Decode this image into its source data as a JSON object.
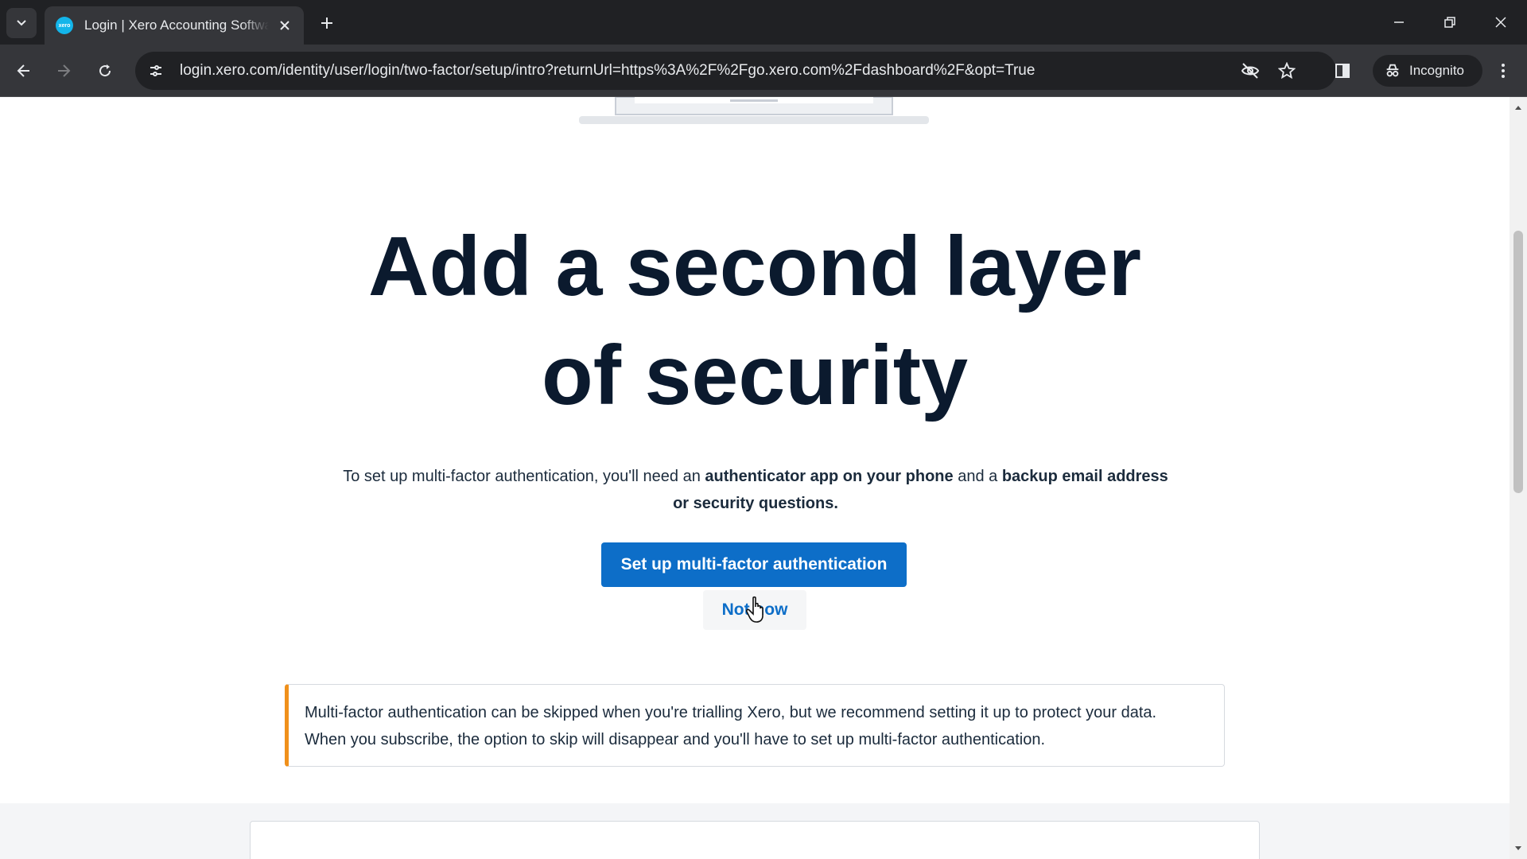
{
  "browser": {
    "tab": {
      "title": "Login | Xero Accounting Software",
      "favicon_text": "xero",
      "favicon_color": "#13b5ea"
    },
    "address_bar": {
      "url": "login.xero.com/identity/user/login/two-factor/setup/intro?returnUrl=https%3A%2F%2Fgo.xero.com%2Fdashboard%2F&opt=True"
    },
    "incognito_label": "Incognito"
  },
  "page": {
    "headline_line1": "Add a second layer",
    "headline_line2": "of security",
    "intro": {
      "part1": "To set up multi-factor authentication, you'll need an ",
      "bold1": "authenticator app on your phone",
      "part2": " and a ",
      "bold2": "backup email address or security questions."
    },
    "primary_button": "Set up multi-factor authentication",
    "secondary_button": "Not now",
    "notice": {
      "line1": "Multi-factor authentication can be skipped when you're trialling Xero, but we recommend setting it up to protect your data.",
      "line2": "When you subscribe, the option to skip will disappear and you'll have to set up multi-factor authentication.",
      "accent_color": "#f0901b"
    },
    "colors": {
      "primary": "#0d6ec8",
      "heading": "#0b1a2e"
    }
  }
}
